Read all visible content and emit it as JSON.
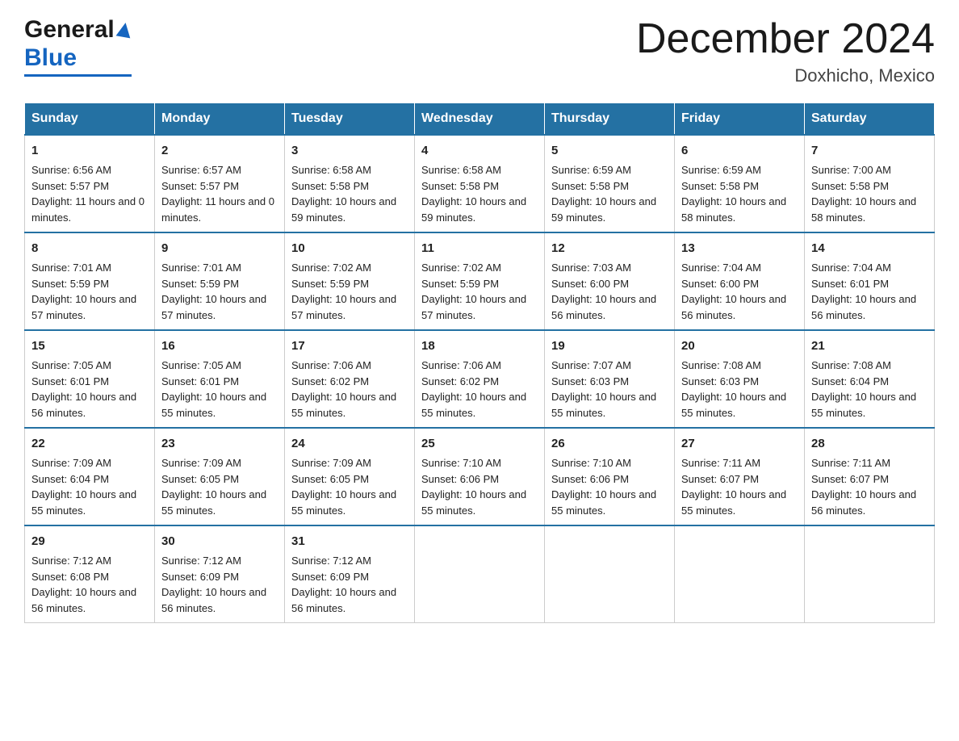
{
  "header": {
    "logo_general": "General",
    "logo_blue": "Blue",
    "month_title": "December 2024",
    "location": "Doxhicho, Mexico"
  },
  "calendar": {
    "days_of_week": [
      "Sunday",
      "Monday",
      "Tuesday",
      "Wednesday",
      "Thursday",
      "Friday",
      "Saturday"
    ],
    "weeks": [
      [
        {
          "day": "1",
          "sunrise": "6:56 AM",
          "sunset": "5:57 PM",
          "daylight": "11 hours and 0 minutes."
        },
        {
          "day": "2",
          "sunrise": "6:57 AM",
          "sunset": "5:57 PM",
          "daylight": "11 hours and 0 minutes."
        },
        {
          "day": "3",
          "sunrise": "6:58 AM",
          "sunset": "5:58 PM",
          "daylight": "10 hours and 59 minutes."
        },
        {
          "day": "4",
          "sunrise": "6:58 AM",
          "sunset": "5:58 PM",
          "daylight": "10 hours and 59 minutes."
        },
        {
          "day": "5",
          "sunrise": "6:59 AM",
          "sunset": "5:58 PM",
          "daylight": "10 hours and 59 minutes."
        },
        {
          "day": "6",
          "sunrise": "6:59 AM",
          "sunset": "5:58 PM",
          "daylight": "10 hours and 58 minutes."
        },
        {
          "day": "7",
          "sunrise": "7:00 AM",
          "sunset": "5:58 PM",
          "daylight": "10 hours and 58 minutes."
        }
      ],
      [
        {
          "day": "8",
          "sunrise": "7:01 AM",
          "sunset": "5:59 PM",
          "daylight": "10 hours and 57 minutes."
        },
        {
          "day": "9",
          "sunrise": "7:01 AM",
          "sunset": "5:59 PM",
          "daylight": "10 hours and 57 minutes."
        },
        {
          "day": "10",
          "sunrise": "7:02 AM",
          "sunset": "5:59 PM",
          "daylight": "10 hours and 57 minutes."
        },
        {
          "day": "11",
          "sunrise": "7:02 AM",
          "sunset": "5:59 PM",
          "daylight": "10 hours and 57 minutes."
        },
        {
          "day": "12",
          "sunrise": "7:03 AM",
          "sunset": "6:00 PM",
          "daylight": "10 hours and 56 minutes."
        },
        {
          "day": "13",
          "sunrise": "7:04 AM",
          "sunset": "6:00 PM",
          "daylight": "10 hours and 56 minutes."
        },
        {
          "day": "14",
          "sunrise": "7:04 AM",
          "sunset": "6:01 PM",
          "daylight": "10 hours and 56 minutes."
        }
      ],
      [
        {
          "day": "15",
          "sunrise": "7:05 AM",
          "sunset": "6:01 PM",
          "daylight": "10 hours and 56 minutes."
        },
        {
          "day": "16",
          "sunrise": "7:05 AM",
          "sunset": "6:01 PM",
          "daylight": "10 hours and 55 minutes."
        },
        {
          "day": "17",
          "sunrise": "7:06 AM",
          "sunset": "6:02 PM",
          "daylight": "10 hours and 55 minutes."
        },
        {
          "day": "18",
          "sunrise": "7:06 AM",
          "sunset": "6:02 PM",
          "daylight": "10 hours and 55 minutes."
        },
        {
          "day": "19",
          "sunrise": "7:07 AM",
          "sunset": "6:03 PM",
          "daylight": "10 hours and 55 minutes."
        },
        {
          "day": "20",
          "sunrise": "7:08 AM",
          "sunset": "6:03 PM",
          "daylight": "10 hours and 55 minutes."
        },
        {
          "day": "21",
          "sunrise": "7:08 AM",
          "sunset": "6:04 PM",
          "daylight": "10 hours and 55 minutes."
        }
      ],
      [
        {
          "day": "22",
          "sunrise": "7:09 AM",
          "sunset": "6:04 PM",
          "daylight": "10 hours and 55 minutes."
        },
        {
          "day": "23",
          "sunrise": "7:09 AM",
          "sunset": "6:05 PM",
          "daylight": "10 hours and 55 minutes."
        },
        {
          "day": "24",
          "sunrise": "7:09 AM",
          "sunset": "6:05 PM",
          "daylight": "10 hours and 55 minutes."
        },
        {
          "day": "25",
          "sunrise": "7:10 AM",
          "sunset": "6:06 PM",
          "daylight": "10 hours and 55 minutes."
        },
        {
          "day": "26",
          "sunrise": "7:10 AM",
          "sunset": "6:06 PM",
          "daylight": "10 hours and 55 minutes."
        },
        {
          "day": "27",
          "sunrise": "7:11 AM",
          "sunset": "6:07 PM",
          "daylight": "10 hours and 55 minutes."
        },
        {
          "day": "28",
          "sunrise": "7:11 AM",
          "sunset": "6:07 PM",
          "daylight": "10 hours and 56 minutes."
        }
      ],
      [
        {
          "day": "29",
          "sunrise": "7:12 AM",
          "sunset": "6:08 PM",
          "daylight": "10 hours and 56 minutes."
        },
        {
          "day": "30",
          "sunrise": "7:12 AM",
          "sunset": "6:09 PM",
          "daylight": "10 hours and 56 minutes."
        },
        {
          "day": "31",
          "sunrise": "7:12 AM",
          "sunset": "6:09 PM",
          "daylight": "10 hours and 56 minutes."
        },
        null,
        null,
        null,
        null
      ]
    ]
  }
}
